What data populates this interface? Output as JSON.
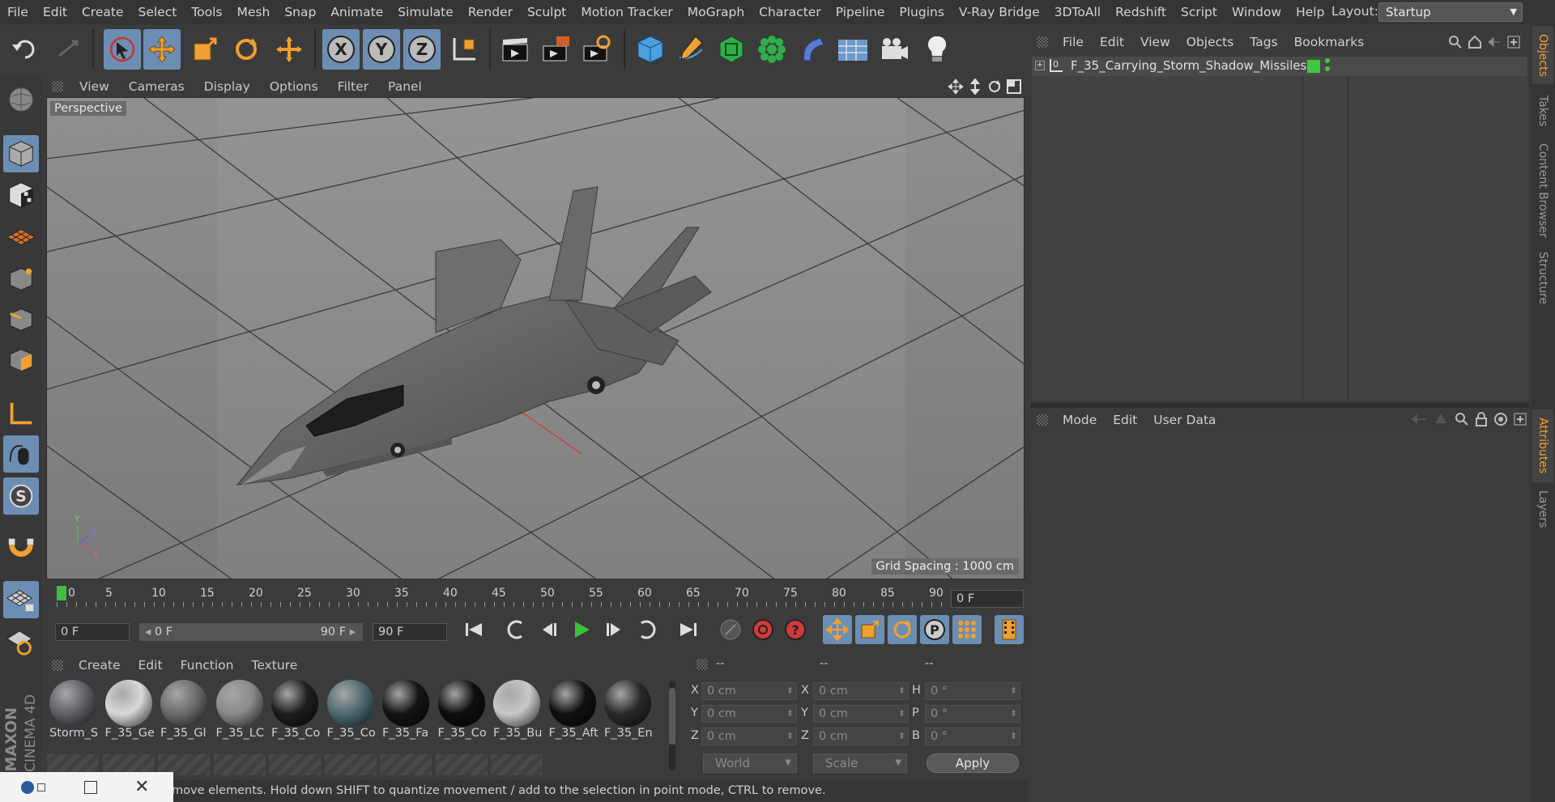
{
  "menubar": {
    "items": [
      "File",
      "Edit",
      "Create",
      "Select",
      "Tools",
      "Mesh",
      "Snap",
      "Animate",
      "Simulate",
      "Render",
      "Sculpt",
      "Motion Tracker",
      "MoGraph",
      "Character",
      "Pipeline",
      "Plugins",
      "V-Ray Bridge",
      "3DToAll",
      "Redshift",
      "Script",
      "Window",
      "Help"
    ],
    "layout_label": "Layout:",
    "layout_value": "Startup"
  },
  "toolbar": {
    "icons": [
      "undo-icon",
      "redo-icon",
      "select-arrow-icon",
      "move-icon",
      "scale-icon",
      "rotate-icon",
      "live-select-icon",
      "x-axis-icon",
      "y-axis-icon",
      "z-axis-icon",
      "world-coord-icon",
      "render-view-icon",
      "render-picture-queue-icon",
      "render-settings-icon",
      "cube-icon",
      "pen-icon",
      "subdivision-icon",
      "array-icon",
      "deformer-icon",
      "floor-icon",
      "camera-icon",
      "light-icon"
    ],
    "axis_x": "X",
    "axis_y": "Y",
    "axis_z": "Z"
  },
  "viewport": {
    "menu": [
      "View",
      "Cameras",
      "Display",
      "Options",
      "Filter",
      "Panel"
    ],
    "label": "Perspective",
    "grid_spacing": "Grid Spacing : 1000 cm",
    "axis_x": "X",
    "axis_y": "Y",
    "axis_z": "Z"
  },
  "timeline": {
    "ticks": [
      "0",
      "5",
      "10",
      "15",
      "20",
      "25",
      "30",
      "35",
      "40",
      "45",
      "50",
      "55",
      "60",
      "65",
      "70",
      "75",
      "80",
      "85",
      "90"
    ],
    "current_frame": "0 F",
    "start_field": "0 F",
    "range_start": "0 F",
    "range_end": "90 F",
    "end_field": "90 F"
  },
  "materials": {
    "menu": [
      "Create",
      "Edit",
      "Function",
      "Texture"
    ],
    "items": [
      {
        "name": "Storm_S",
        "color": "#5e6066"
      },
      {
        "name": "F_35_Ge",
        "color": "#d8d8d8"
      },
      {
        "name": "F_35_Gl",
        "color": "#6b6b6b"
      },
      {
        "name": "F_35_LC",
        "color": "#8a8a8a"
      },
      {
        "name": "F_35_Co",
        "color": "#1e1e1e"
      },
      {
        "name": "F_35_Co",
        "color": "#4e6a70"
      },
      {
        "name": "F_35_Fa",
        "color": "#141414"
      },
      {
        "name": "F_35_Co",
        "color": "#0e0e0e"
      },
      {
        "name": "F_35_Bu",
        "color": "#c8c8c8"
      },
      {
        "name": "F_35_Aft",
        "color": "#111111"
      },
      {
        "name": "F_35_En",
        "color": "#2a2a2a"
      }
    ]
  },
  "coords": {
    "headers": [
      "--",
      "--",
      "--"
    ],
    "row_labels_a": [
      "X",
      "Y",
      "Z"
    ],
    "row_labels_b": [
      "X",
      "Y",
      "Z"
    ],
    "row_labels_c": [
      "H",
      "P",
      "B"
    ],
    "pos": [
      "0 cm",
      "0 cm",
      "0 cm"
    ],
    "size": [
      "0 cm",
      "0 cm",
      "0 cm"
    ],
    "rot": [
      "0 °",
      "0 °",
      "0 °"
    ],
    "mode_select": "World",
    "scale_select": "Scale",
    "apply": "Apply"
  },
  "status": {
    "text": "move elements. Hold down SHIFT to quantize movement / add to the selection in point mode, CTRL to remove."
  },
  "object_manager": {
    "menu": [
      "File",
      "Edit",
      "View",
      "Objects",
      "Tags",
      "Bookmarks"
    ],
    "objects": [
      {
        "name": "F_35_Carrying_Storm_Shadow_Missiles"
      }
    ]
  },
  "attributes": {
    "menu": [
      "Mode",
      "Edit",
      "User Data"
    ]
  },
  "right_tabs": {
    "top": [
      "Objects",
      "Takes",
      "Content Browser",
      "Structure"
    ],
    "bottom": [
      "Attributes",
      "Layers"
    ]
  },
  "branding": {
    "line1": "MAXON",
    "line2": "CINEMA 4D"
  },
  "colors": {
    "accent": "#6d8eb3",
    "play_green": "#3fbf3f",
    "record_red": "#d23a3a",
    "orange_icon": "#f0a030",
    "layer_green": "#3ec83e"
  }
}
